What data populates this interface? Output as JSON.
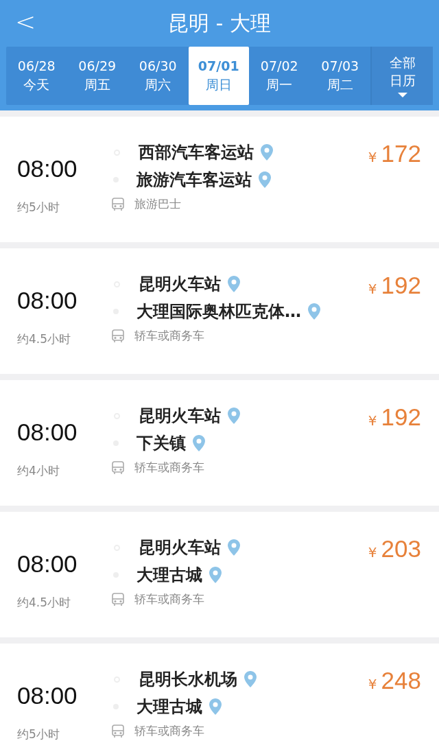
{
  "header": {
    "back": "<",
    "title": "昆明 - 大理"
  },
  "dates": [
    {
      "date": "06/28",
      "day": "今天",
      "selected": false
    },
    {
      "date": "06/29",
      "day": "周五",
      "selected": false
    },
    {
      "date": "06/30",
      "day": "周六",
      "selected": false
    },
    {
      "date": "07/01",
      "day": "周日",
      "selected": true
    },
    {
      "date": "07/02",
      "day": "周一",
      "selected": false
    },
    {
      "date": "07/03",
      "day": "周二",
      "selected": false
    }
  ],
  "calendar_button": {
    "line_1": "全部",
    "line_2": "日历"
  },
  "trips": [
    {
      "time": "08:00",
      "duration": "约5小时",
      "from": "西部汽车客运站",
      "to": "旅游汽车客运站",
      "vehicle": "旅游巴士",
      "currency": "¥",
      "price": "172"
    },
    {
      "time": "08:00",
      "duration": "约4.5小时",
      "from": "昆明火车站",
      "to": "大理国际奥林匹克体…",
      "vehicle": "轿车或商务车",
      "currency": "¥",
      "price": "192"
    },
    {
      "time": "08:00",
      "duration": "约4小时",
      "from": "昆明火车站",
      "to": "下关镇",
      "vehicle": "轿车或商务车",
      "currency": "¥",
      "price": "192"
    },
    {
      "time": "08:00",
      "duration": "约4.5小时",
      "from": "昆明火车站",
      "to": "大理古城",
      "vehicle": "轿车或商务车",
      "currency": "¥",
      "price": "203"
    },
    {
      "time": "08:00",
      "duration": "约5小时",
      "from": "昆明长水机场",
      "to": "大理古城",
      "vehicle": "轿车或商务车",
      "currency": "¥",
      "price": "248"
    }
  ]
}
